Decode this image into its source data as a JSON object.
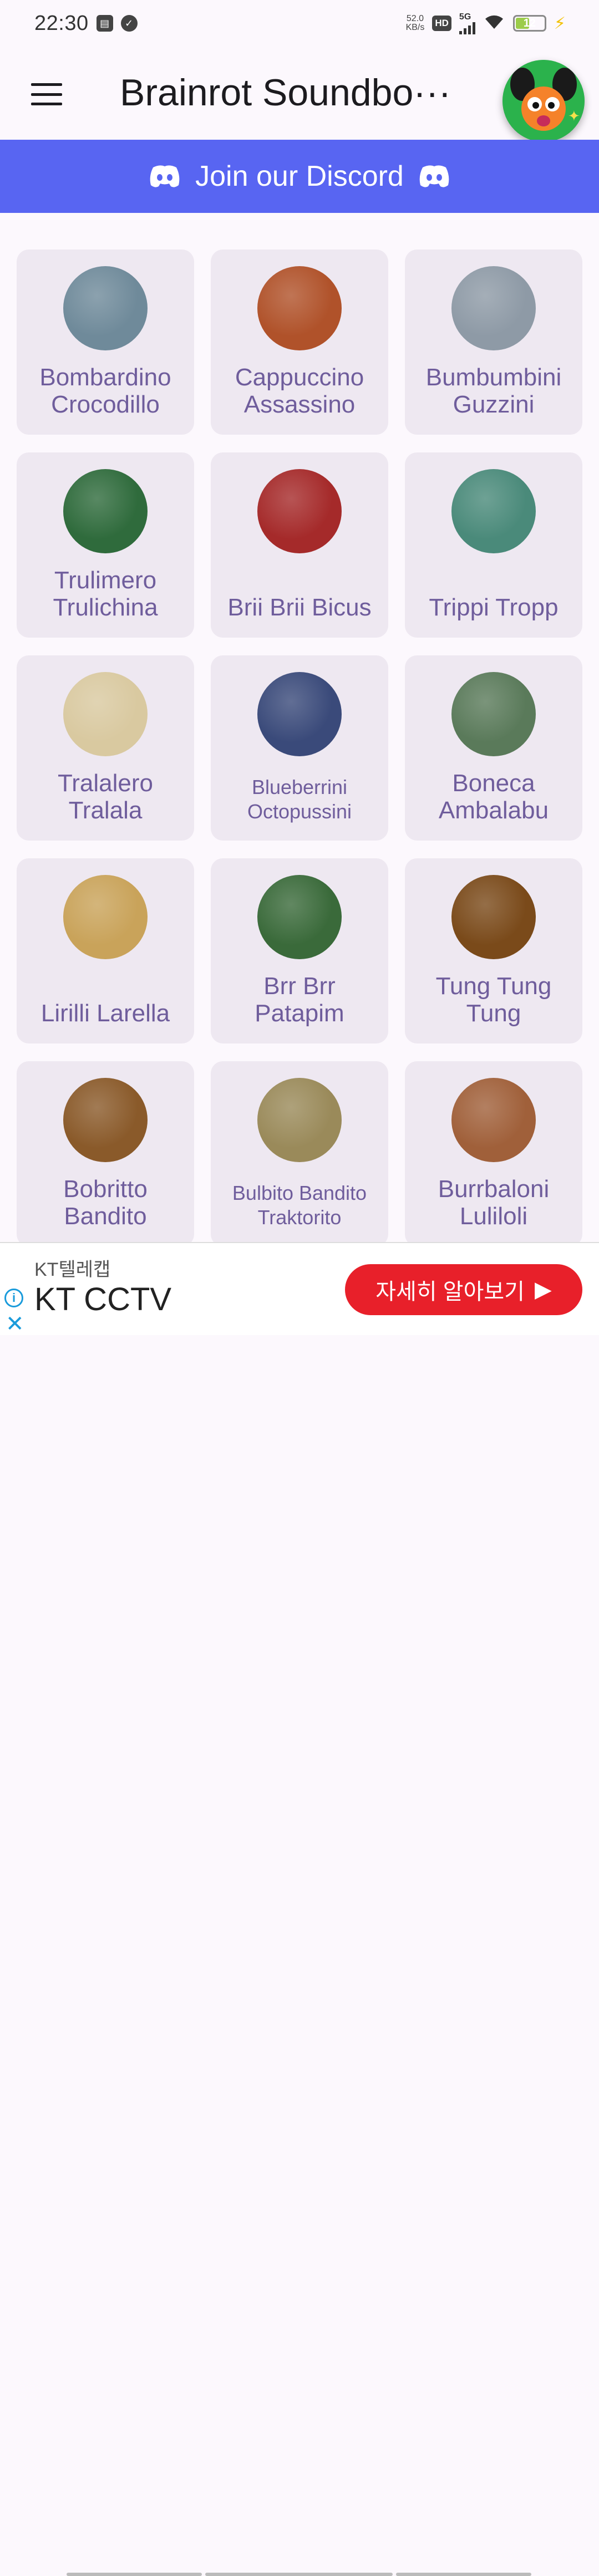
{
  "status_bar": {
    "time": "22:30",
    "net_speed_value": "52.0",
    "net_speed_unit": "KB/s",
    "hd_badge": "HD",
    "network_type": "5G",
    "battery_level": "12"
  },
  "app_bar": {
    "title": "Brainrot Soundbo···"
  },
  "discord_banner": {
    "label": "Join our Discord"
  },
  "sounds": [
    {
      "name": "Bombardino Crocodillo",
      "line1": "Bombardino",
      "line2": "Crocodillo",
      "color": "#6f8a9a"
    },
    {
      "name": "Cappuccino Assassino",
      "line1": "Cappuccino",
      "line2": "Assassino",
      "color": "#b0522a"
    },
    {
      "name": "Bumbumbini Guzzini",
      "line1": "Bumbumbini",
      "line2": "Guzzini",
      "color": "#8e9aa6"
    },
    {
      "name": "Trulimero Trulichina",
      "line1": "Trulimero",
      "line2": "Trulichina",
      "color": "#2f6b3c"
    },
    {
      "name": "Brii Brii Bicus",
      "line1": "",
      "line2": "Brii Brii Bicus",
      "color": "#a52a2a"
    },
    {
      "name": "Trippi Tropp",
      "line1": "",
      "line2": "Trippi Tropp",
      "color": "#4a8a7a"
    },
    {
      "name": "Tralalero Tralala",
      "line1": "Tralalero",
      "line2": "Tralala",
      "color": "#d9c9a0"
    },
    {
      "name": "Blueberrini Octopussini",
      "line1": "Blueberrini",
      "line2": "Octopussini",
      "color": "#3a4a7a"
    },
    {
      "name": "Boneca Ambalabu",
      "line1": "Boneca",
      "line2": "Ambalabu",
      "color": "#5a7a5a"
    },
    {
      "name": "Lirilli Larella",
      "line1": "",
      "line2": "Lirilli Larella",
      "color": "#c9a35a"
    },
    {
      "name": "Brr Brr Patapim",
      "line1": "Brr Brr",
      "line2": "Patapim",
      "color": "#3a6a3a"
    },
    {
      "name": "Tung Tung Tung",
      "line1": "Tung Tung",
      "line2": "Tung",
      "color": "#7a4a1a"
    },
    {
      "name": "Bobritto Bandito",
      "line1": "Bobritto",
      "line2": "Bandito",
      "color": "#8a5a2a"
    },
    {
      "name": "Bulbito Bandito Traktorito",
      "line1": "Bulbito Bandito",
      "line2": "Traktorito",
      "color": "#9a8a5a"
    },
    {
      "name": "Burrbaloni Luliloli",
      "line1": "Burrbaloni",
      "line2": "Luliloli",
      "color": "#a0603a"
    }
  ],
  "ad": {
    "brand": "KT텔레캡",
    "title": "KT CCTV",
    "cta": "자세히 알아보기"
  },
  "colors": {
    "accent": "#5865f2",
    "card_bg": "#eee8f1",
    "label": "#6f5d9c",
    "ad_cta": "#e8202a"
  }
}
